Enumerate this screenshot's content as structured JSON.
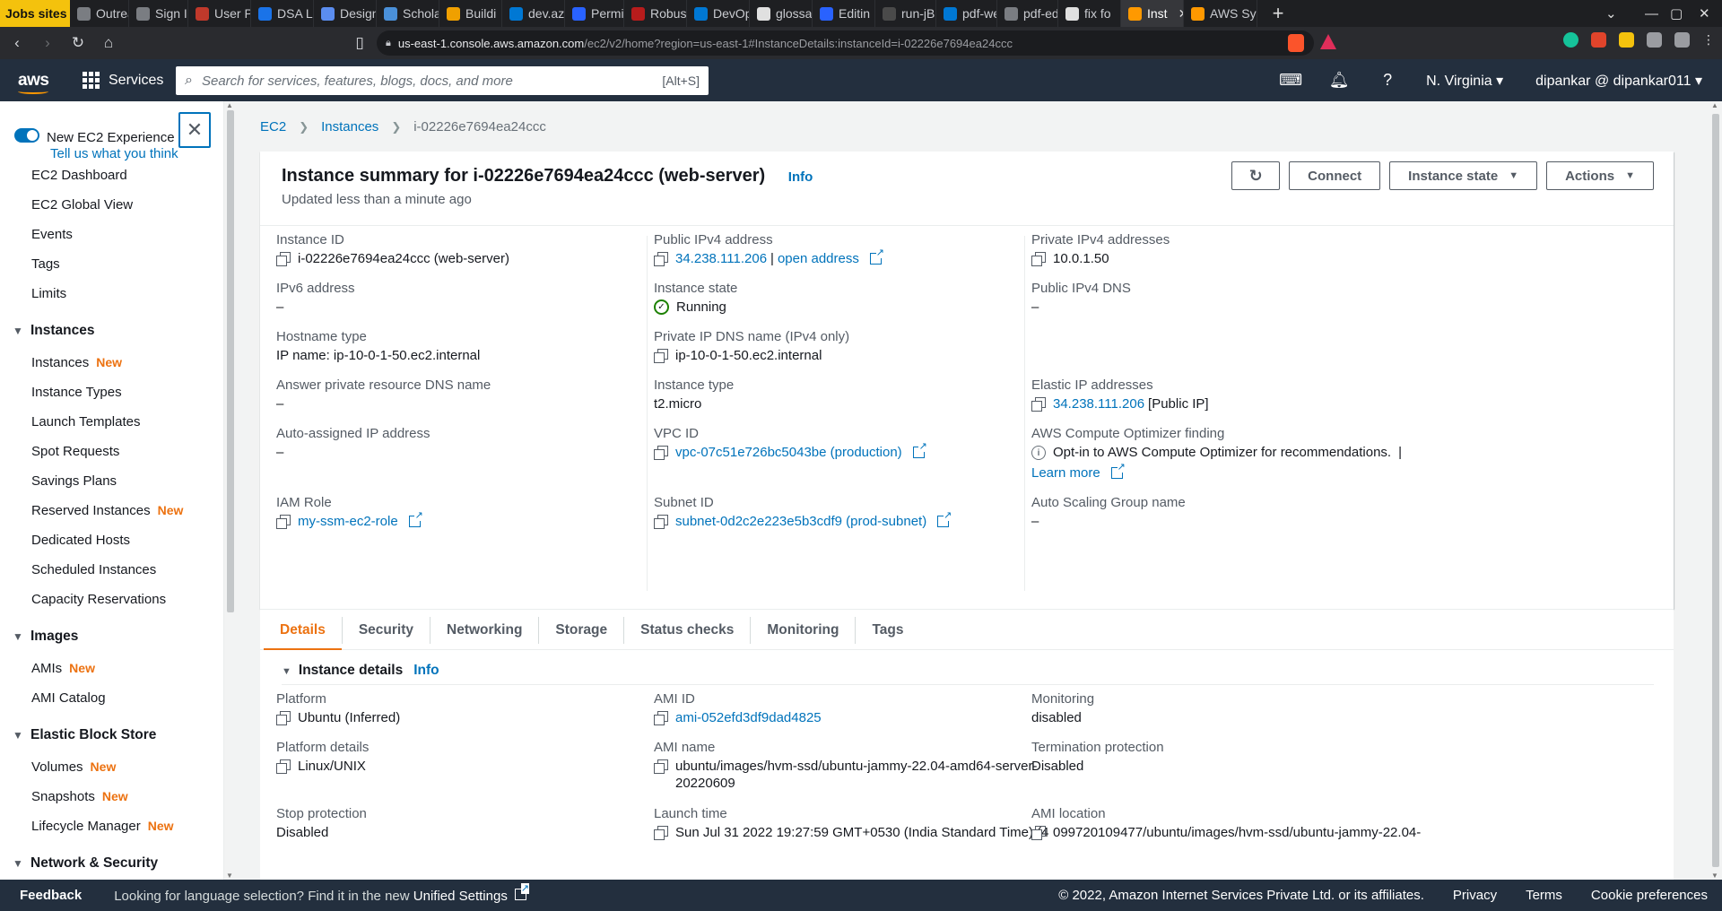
{
  "browser": {
    "tabs": [
      {
        "label": "Jobs sites",
        "color": "#f4c20d"
      },
      {
        "label": "Outrea",
        "color": "#7a7d82"
      },
      {
        "label": "Sign I",
        "color": "#7a7d82"
      },
      {
        "label": "User P",
        "color": "#c0392b"
      },
      {
        "label": "DSA Le",
        "color": "#1a73e8"
      },
      {
        "label": "Design",
        "color": "#5b8def"
      },
      {
        "label": "Schola",
        "color": "#4a90d9"
      },
      {
        "label": "Buildi",
        "color": "#f0a000"
      },
      {
        "label": "dev.az",
        "color": "#0078d4"
      },
      {
        "label": "Permit",
        "color": "#2962ff"
      },
      {
        "label": "Robust",
        "color": "#b71c1c"
      },
      {
        "label": "DevOps",
        "color": "#0078d4"
      },
      {
        "label": "glossa",
        "color": "#e0e0e0"
      },
      {
        "label": "Editin",
        "color": "#2962ff"
      },
      {
        "label": "run-jB",
        "color": "#4a4a4a"
      },
      {
        "label": "pdf-we",
        "color": "#0078d4"
      },
      {
        "label": "pdf-ed",
        "color": "#7a7d82"
      },
      {
        "label": "fix fo",
        "color": "#e0e0e0"
      },
      {
        "label": "Inst",
        "color": "#ff9900",
        "active": true
      },
      {
        "label": "AWS Sy",
        "color": "#ff9900"
      }
    ],
    "new_tab": "+",
    "url_host": "us-east-1.console.aws.amazon.com",
    "url_path": "/ec2/v2/home?region=us-east-1#InstanceDetails:instanceId=i-02226e7694ea24ccc"
  },
  "aws_header": {
    "logo": "aws",
    "services_label": "Services",
    "search_placeholder": "Search for services, features, blogs, docs, and more",
    "search_shortcut": "[Alt+S]",
    "region": "N. Virginia",
    "account": "dipankar @ dipankar011"
  },
  "sidebar": {
    "new_experience_title": "New EC2 Experience",
    "new_experience_link": "Tell us what you think",
    "top_items": [
      "EC2 Dashboard",
      "EC2 Global View",
      "Events",
      "Tags",
      "Limits"
    ],
    "sections": [
      {
        "title": "Instances",
        "items": [
          {
            "label": "Instances",
            "badge": "New"
          },
          {
            "label": "Instance Types",
            "badge": ""
          },
          {
            "label": "Launch Templates",
            "badge": ""
          },
          {
            "label": "Spot Requests",
            "badge": ""
          },
          {
            "label": "Savings Plans",
            "badge": ""
          },
          {
            "label": "Reserved Instances",
            "badge": "New"
          },
          {
            "label": "Dedicated Hosts",
            "badge": ""
          },
          {
            "label": "Scheduled Instances",
            "badge": ""
          },
          {
            "label": "Capacity Reservations",
            "badge": ""
          }
        ]
      },
      {
        "title": "Images",
        "items": [
          {
            "label": "AMIs",
            "badge": "New"
          },
          {
            "label": "AMI Catalog",
            "badge": ""
          }
        ]
      },
      {
        "title": "Elastic Block Store",
        "items": [
          {
            "label": "Volumes",
            "badge": "New"
          },
          {
            "label": "Snapshots",
            "badge": "New"
          },
          {
            "label": "Lifecycle Manager",
            "badge": "New"
          }
        ]
      },
      {
        "title": "Network & Security",
        "items": []
      }
    ]
  },
  "breadcrumb": [
    "EC2",
    "Instances",
    "i-02226e7694ea24ccc"
  ],
  "summary": {
    "title": "Instance summary for i-02226e7694ea24ccc (web-server)",
    "info": "Info",
    "updated": "Updated less than a minute ago",
    "buttons": {
      "connect": "Connect",
      "instance_state": "Instance state",
      "actions": "Actions"
    },
    "col1": {
      "instance_id_label": "Instance ID",
      "instance_id": "i-02226e7694ea24ccc (web-server)",
      "ipv6_label": "IPv6 address",
      "ipv6": "–",
      "hostname_type_label": "Hostname type",
      "hostname_type": "IP name: ip-10-0-1-50.ec2.internal",
      "answer_dns_label": "Answer private resource DNS name",
      "answer_dns": "–",
      "auto_ip_label": "Auto-assigned IP address",
      "auto_ip": "–",
      "iam_label": "IAM Role",
      "iam": "my-ssm-ec2-role"
    },
    "col2": {
      "public_ipv4_label": "Public IPv4 address",
      "public_ipv4": "34.238.111.206",
      "open_address": "open address",
      "pipe": "|",
      "state_label": "Instance state",
      "state": "Running",
      "private_dns_label": "Private IP DNS name (IPv4 only)",
      "private_dns": "ip-10-0-1-50.ec2.internal",
      "type_label": "Instance type",
      "type": "t2.micro",
      "vpc_label": "VPC ID",
      "vpc": "vpc-07c51e726bc5043be (production)",
      "subnet_label": "Subnet ID",
      "subnet": "subnet-0d2c2e223e5b3cdf9 (prod-subnet)"
    },
    "col3": {
      "private_ipv4_label": "Private IPv4 addresses",
      "private_ipv4": "10.0.1.50",
      "public_dns_label": "Public IPv4 DNS",
      "public_dns": "–",
      "elastic_label": "Elastic IP addresses",
      "elastic": "34.238.111.206",
      "elastic_suffix": "[Public IP]",
      "optimizer_label": "AWS Compute Optimizer finding",
      "optimizer": "Opt-in to AWS Compute Optimizer for recommendations.",
      "optimizer_pipe": "|",
      "learn_more": "Learn more",
      "asg_label": "Auto Scaling Group name",
      "asg": "–"
    }
  },
  "detail_tabs": [
    "Details",
    "Security",
    "Networking",
    "Storage",
    "Status checks",
    "Monitoring",
    "Tags"
  ],
  "instance_details": {
    "heading": "Instance details",
    "info": "Info",
    "platform_label": "Platform",
    "platform": "Ubuntu (Inferred)",
    "platform_details_label": "Platform details",
    "platform_details": "Linux/UNIX",
    "stop_protection_label": "Stop protection",
    "stop_protection": "Disabled",
    "ami_id_label": "AMI ID",
    "ami_id": "ami-052efd3df9dad4825",
    "ami_name_label": "AMI name",
    "ami_name_1": "ubuntu/images/hvm-ssd/ubuntu-jammy-22.04-amd64-server-",
    "ami_name_2": "20220609",
    "launch_time_label": "Launch time",
    "launch_time": "Sun Jul 31 2022 19:27:59 GMT+0530 (India Standard Time) (4",
    "monitoring_label": "Monitoring",
    "monitoring": "disabled",
    "termination_label": "Termination protection",
    "termination": "Disabled",
    "ami_location_label": "AMI location",
    "ami_location": "099720109477/ubuntu/images/hvm-ssd/ubuntu-jammy-22.04-"
  },
  "footer": {
    "feedback": "Feedback",
    "lang_text": "Looking for language selection? Find it in the new",
    "lang_link": "Unified Settings",
    "copyright": "© 2022, Amazon Internet Services Private Ltd. or its affiliates.",
    "privacy": "Privacy",
    "terms": "Terms",
    "cookies": "Cookie preferences"
  }
}
